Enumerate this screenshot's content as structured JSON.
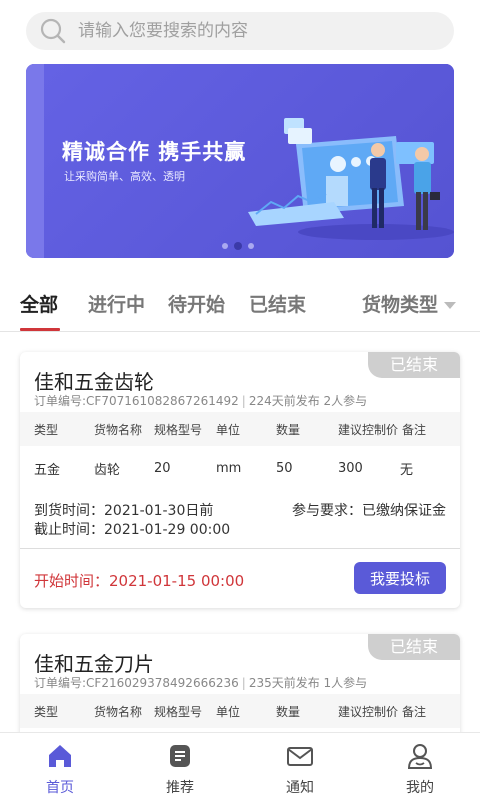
{
  "search": {
    "placeholder": "请输入您要搜索的内容"
  },
  "banner": {
    "title": "精诚合作  携手共赢",
    "subtitle": "让采购简单、高效、透明",
    "active_dot": 1,
    "dot_count": 3
  },
  "tabs": [
    {
      "label": "全部"
    },
    {
      "label": "进行中"
    },
    {
      "label": "待开始"
    },
    {
      "label": "已结束"
    },
    {
      "label": "货物类型"
    }
  ],
  "table_headers": [
    "类型",
    "货物名称",
    "规格型号",
    "单位",
    "数量",
    "建议控制价",
    "备注"
  ],
  "cards": [
    {
      "status": "已结束",
      "title": "佳和五金齿轮",
      "order_no": "订单编号:CF707161082867261492",
      "published": "224天前发布",
      "participants": "2人参与",
      "row": [
        "五金",
        "齿轮",
        "20",
        "mm",
        "50",
        "300",
        "无"
      ],
      "arrival": "到货时间：2021-01-30日前",
      "deadline": "截止时间：2021-01-29 00:00",
      "requirement": "参与要求：已缴纳保证金",
      "start_time": "开始时间：2021-01-15 00:00",
      "bid_label": "我要投标"
    },
    {
      "status": "已结束",
      "title": "佳和五金刀片",
      "order_no": "订单编号:CF216029378492666236",
      "published": "235天前发布",
      "participants": "1人参与"
    }
  ],
  "nav": [
    {
      "label": "首页",
      "icon": "home-icon",
      "active": true
    },
    {
      "label": "推荐",
      "icon": "recommend-icon",
      "active": false
    },
    {
      "label": "通知",
      "icon": "mail-icon",
      "active": false
    },
    {
      "label": "我的",
      "icon": "user-icon",
      "active": false
    }
  ],
  "colors": {
    "accent": "#5a5ad8",
    "red": "#d0363a",
    "status_bg": "#cfcfcf"
  }
}
